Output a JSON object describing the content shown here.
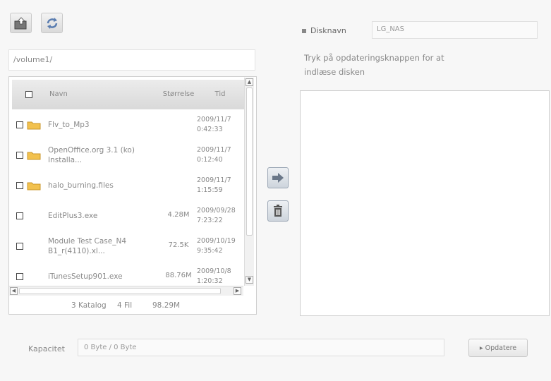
{
  "toolbar": {
    "upload_icon": "upload-folder-icon",
    "refresh_icon": "refresh-icon"
  },
  "path": "/volume1/",
  "file_table": {
    "headers": {
      "name": "Navn",
      "size": "Størrelse",
      "time": "Tid"
    },
    "rows": [
      {
        "type": "folder",
        "name_line1": "Flv_to_Mp3",
        "name_line2": "",
        "size": "",
        "time_line1": "2009/11/7",
        "time_line2": "0:42:33"
      },
      {
        "type": "folder",
        "name_line1": "OpenOffice.org 3.1 (ko)",
        "name_line2": "Installa...",
        "size": "",
        "time_line1": "2009/11/7",
        "time_line2": "0:12:40"
      },
      {
        "type": "folder",
        "name_line1": "halo_burning.files",
        "name_line2": "",
        "size": "",
        "time_line1": "2009/11/7",
        "time_line2": "1:15:59"
      },
      {
        "type": "file",
        "name_line1": "EditPlus3.exe",
        "name_line2": "",
        "size": "4.28M",
        "time_line1": "2009/09/28",
        "time_line2": "7:23:22"
      },
      {
        "type": "file",
        "name_line1": "Module Test Case_N4",
        "name_line2": "B1_r(4110).xl...",
        "size": "72.5K",
        "time_line1": "2009/10/19",
        "time_line2": "9:35:42"
      },
      {
        "type": "file",
        "name_line1": "iTunesSetup901.exe",
        "name_line2": "",
        "size": "88.76M",
        "time_line1": "2009/10/8",
        "time_line2": "1:20:32"
      }
    ]
  },
  "summary": {
    "folders": "3 Katalog",
    "files": "4 Fil",
    "total": "98.29M"
  },
  "right": {
    "disk_label": "Disknavn",
    "disk_value": "LG_NAS",
    "info_line1": "Tryk på opdateringsknappen for at",
    "info_line2": "indlæse disken"
  },
  "bottom": {
    "capacity_label": "Kapacitet",
    "capacity_value": "0 Byte / 0 Byte",
    "update_label": "▸ Opdatere"
  },
  "colors": {
    "header_bg": "#d9d9d9",
    "folder": "#f2c14e",
    "border": "#cfcfcf"
  }
}
